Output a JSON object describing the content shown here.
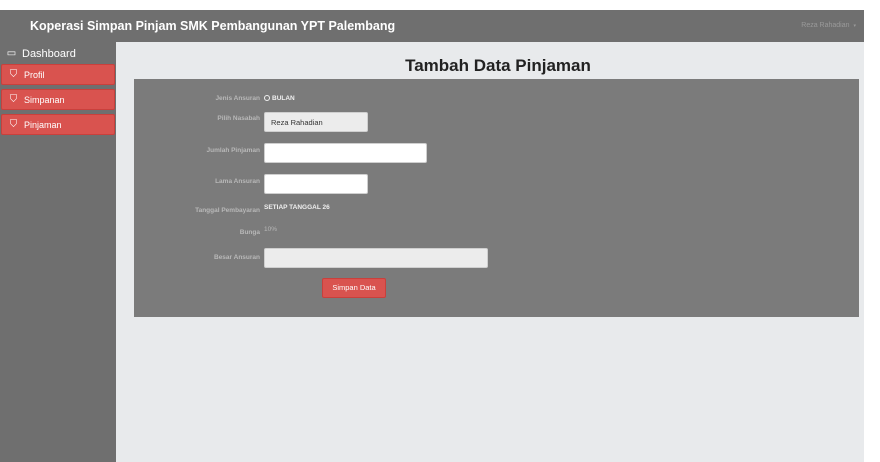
{
  "app": {
    "title": "Koperasi Simpan Pinjam SMK Pembangunan YPT Palembang",
    "user_name": "Reza Rahadian",
    "user_caret": "▾"
  },
  "sidebar": {
    "items": [
      {
        "label": "Dashboard",
        "icon": "laptop-icon",
        "glyph": "▭"
      },
      {
        "label": "Profil",
        "icon": "tag-icon",
        "glyph": "⛉"
      },
      {
        "label": "Simpanan",
        "icon": "tag-icon",
        "glyph": "⛉"
      },
      {
        "label": "Pinjaman",
        "icon": "tag-icon",
        "glyph": "⛉"
      }
    ]
  },
  "page": {
    "title": "Tambah Data Pinjaman"
  },
  "form": {
    "jenis_angsuran": {
      "label": "Jenis Ansuran",
      "value": "BULAN",
      "icon": "radio-icon"
    },
    "pilih_nasabah": {
      "label": "Pilih Nasabah",
      "value": "Reza Rahadian"
    },
    "jumlah_pinjaman": {
      "label": "Jumlah Pinjaman",
      "value": ""
    },
    "lama_angsuran": {
      "label": "Lama Ansuran",
      "value": ""
    },
    "tanggal_pembayaran": {
      "label": "Tanggal Pembayaran",
      "value": "SETIAP TANGGAL 26"
    },
    "bunga": {
      "label": "Bunga",
      "value": "10%"
    },
    "besar_angsuran": {
      "label": "Besar Ansuran",
      "value": ""
    },
    "submit_label": "Simpan Data"
  },
  "colors": {
    "navbar": "#6f6f6f",
    "accent_red": "#d9534f",
    "panel": "#7b7b7b",
    "background": "#e8eaec"
  }
}
